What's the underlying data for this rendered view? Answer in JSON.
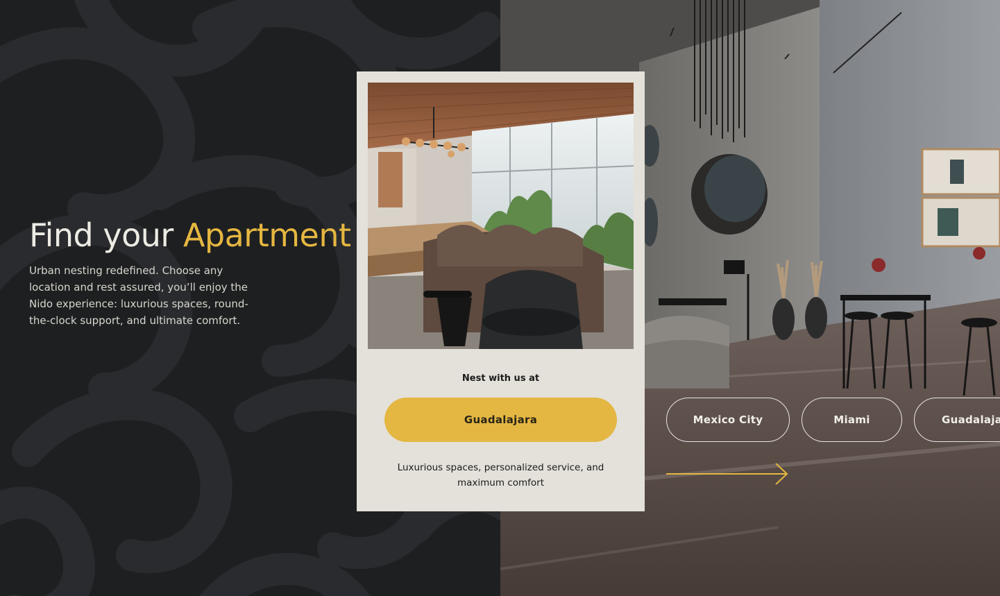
{
  "hero": {
    "title_main": "Find your",
    "title_accent": "Apartment",
    "description": "Urban nesting redefined. Choose any location and rest assured, you’ll enjoy the Nido experience: luxurious spaces, round-the-clock support, and ultimate comfort."
  },
  "card": {
    "label": "Nest with us at",
    "selected_city": "Guadalajara",
    "tagline": "Luxurious spaces, personalized service, and maximum comfort"
  },
  "cities": [
    "Mexico City",
    "Miami",
    "Guadalajara"
  ],
  "icons": {
    "next": "arrow-right-icon"
  },
  "colors": {
    "accent": "#e5b740",
    "dark_bg": "#1e1f21",
    "card_bg": "#e4e1da"
  }
}
